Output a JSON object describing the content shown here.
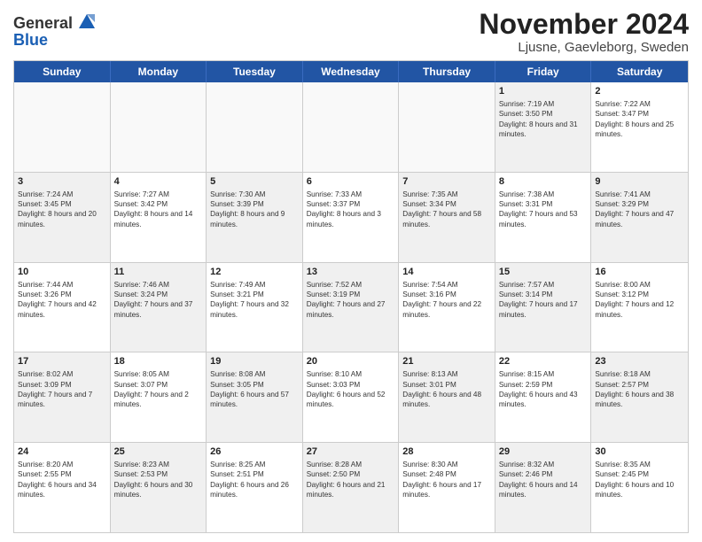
{
  "logo": {
    "line1": "General",
    "line2": "Blue"
  },
  "title": "November 2024",
  "location": "Ljusne, Gaevleborg, Sweden",
  "header_days": [
    "Sunday",
    "Monday",
    "Tuesday",
    "Wednesday",
    "Thursday",
    "Friday",
    "Saturday"
  ],
  "rows": [
    [
      {
        "day": "",
        "text": "",
        "empty": true
      },
      {
        "day": "",
        "text": "",
        "empty": true
      },
      {
        "day": "",
        "text": "",
        "empty": true
      },
      {
        "day": "",
        "text": "",
        "empty": true
      },
      {
        "day": "",
        "text": "",
        "empty": true
      },
      {
        "day": "1",
        "text": "Sunrise: 7:19 AM\nSunset: 3:50 PM\nDaylight: 8 hours and 31 minutes.",
        "shaded": true
      },
      {
        "day": "2",
        "text": "Sunrise: 7:22 AM\nSunset: 3:47 PM\nDaylight: 8 hours and 25 minutes.",
        "shaded": false
      }
    ],
    [
      {
        "day": "3",
        "text": "Sunrise: 7:24 AM\nSunset: 3:45 PM\nDaylight: 8 hours and 20 minutes.",
        "shaded": true
      },
      {
        "day": "4",
        "text": "Sunrise: 7:27 AM\nSunset: 3:42 PM\nDaylight: 8 hours and 14 minutes.",
        "shaded": false
      },
      {
        "day": "5",
        "text": "Sunrise: 7:30 AM\nSunset: 3:39 PM\nDaylight: 8 hours and 9 minutes.",
        "shaded": true
      },
      {
        "day": "6",
        "text": "Sunrise: 7:33 AM\nSunset: 3:37 PM\nDaylight: 8 hours and 3 minutes.",
        "shaded": false
      },
      {
        "day": "7",
        "text": "Sunrise: 7:35 AM\nSunset: 3:34 PM\nDaylight: 7 hours and 58 minutes.",
        "shaded": true
      },
      {
        "day": "8",
        "text": "Sunrise: 7:38 AM\nSunset: 3:31 PM\nDaylight: 7 hours and 53 minutes.",
        "shaded": false
      },
      {
        "day": "9",
        "text": "Sunrise: 7:41 AM\nSunset: 3:29 PM\nDaylight: 7 hours and 47 minutes.",
        "shaded": true
      }
    ],
    [
      {
        "day": "10",
        "text": "Sunrise: 7:44 AM\nSunset: 3:26 PM\nDaylight: 7 hours and 42 minutes.",
        "shaded": false
      },
      {
        "day": "11",
        "text": "Sunrise: 7:46 AM\nSunset: 3:24 PM\nDaylight: 7 hours and 37 minutes.",
        "shaded": true
      },
      {
        "day": "12",
        "text": "Sunrise: 7:49 AM\nSunset: 3:21 PM\nDaylight: 7 hours and 32 minutes.",
        "shaded": false
      },
      {
        "day": "13",
        "text": "Sunrise: 7:52 AM\nSunset: 3:19 PM\nDaylight: 7 hours and 27 minutes.",
        "shaded": true
      },
      {
        "day": "14",
        "text": "Sunrise: 7:54 AM\nSunset: 3:16 PM\nDaylight: 7 hours and 22 minutes.",
        "shaded": false
      },
      {
        "day": "15",
        "text": "Sunrise: 7:57 AM\nSunset: 3:14 PM\nDaylight: 7 hours and 17 minutes.",
        "shaded": true
      },
      {
        "day": "16",
        "text": "Sunrise: 8:00 AM\nSunset: 3:12 PM\nDaylight: 7 hours and 12 minutes.",
        "shaded": false
      }
    ],
    [
      {
        "day": "17",
        "text": "Sunrise: 8:02 AM\nSunset: 3:09 PM\nDaylight: 7 hours and 7 minutes.",
        "shaded": true
      },
      {
        "day": "18",
        "text": "Sunrise: 8:05 AM\nSunset: 3:07 PM\nDaylight: 7 hours and 2 minutes.",
        "shaded": false
      },
      {
        "day": "19",
        "text": "Sunrise: 8:08 AM\nSunset: 3:05 PM\nDaylight: 6 hours and 57 minutes.",
        "shaded": true
      },
      {
        "day": "20",
        "text": "Sunrise: 8:10 AM\nSunset: 3:03 PM\nDaylight: 6 hours and 52 minutes.",
        "shaded": false
      },
      {
        "day": "21",
        "text": "Sunrise: 8:13 AM\nSunset: 3:01 PM\nDaylight: 6 hours and 48 minutes.",
        "shaded": true
      },
      {
        "day": "22",
        "text": "Sunrise: 8:15 AM\nSunset: 2:59 PM\nDaylight: 6 hours and 43 minutes.",
        "shaded": false
      },
      {
        "day": "23",
        "text": "Sunrise: 8:18 AM\nSunset: 2:57 PM\nDaylight: 6 hours and 38 minutes.",
        "shaded": true
      }
    ],
    [
      {
        "day": "24",
        "text": "Sunrise: 8:20 AM\nSunset: 2:55 PM\nDaylight: 6 hours and 34 minutes.",
        "shaded": false
      },
      {
        "day": "25",
        "text": "Sunrise: 8:23 AM\nSunset: 2:53 PM\nDaylight: 6 hours and 30 minutes.",
        "shaded": true
      },
      {
        "day": "26",
        "text": "Sunrise: 8:25 AM\nSunset: 2:51 PM\nDaylight: 6 hours and 26 minutes.",
        "shaded": false
      },
      {
        "day": "27",
        "text": "Sunrise: 8:28 AM\nSunset: 2:50 PM\nDaylight: 6 hours and 21 minutes.",
        "shaded": true
      },
      {
        "day": "28",
        "text": "Sunrise: 8:30 AM\nSunset: 2:48 PM\nDaylight: 6 hours and 17 minutes.",
        "shaded": false
      },
      {
        "day": "29",
        "text": "Sunrise: 8:32 AM\nSunset: 2:46 PM\nDaylight: 6 hours and 14 minutes.",
        "shaded": true
      },
      {
        "day": "30",
        "text": "Sunrise: 8:35 AM\nSunset: 2:45 PM\nDaylight: 6 hours and 10 minutes.",
        "shaded": false
      }
    ]
  ]
}
